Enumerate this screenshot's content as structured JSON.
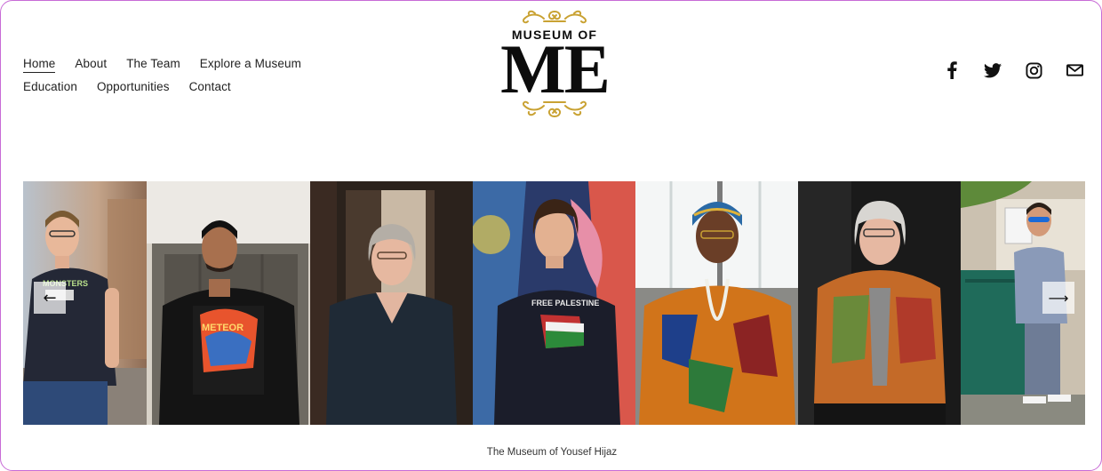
{
  "nav": {
    "row1": [
      {
        "label": "Home",
        "active": true
      },
      {
        "label": "About"
      },
      {
        "label": "The Team"
      },
      {
        "label": "Explore a Museum"
      }
    ],
    "row2": [
      {
        "label": "Education"
      },
      {
        "label": "Opportunities"
      },
      {
        "label": "Contact"
      }
    ]
  },
  "logo": {
    "line1": "MUSEUM OF",
    "line2": "ME",
    "gold": "#c9a233"
  },
  "social": [
    "facebook-icon",
    "twitter-icon",
    "instagram-icon",
    "email-icon"
  ],
  "gallery": {
    "portraits": [
      {
        "name": "portrait-man-monsters-tshirt",
        "shirt_text": "MONSTERS EXIST"
      },
      {
        "name": "portrait-young-man-graphic-tshirt",
        "shirt_text": "METEOR"
      },
      {
        "name": "portrait-woman-grey-hair-polo"
      },
      {
        "name": "portrait-boy-free-palestine-hoodie",
        "shirt_text": "FREE PALESTINE"
      },
      {
        "name": "portrait-elder-woman-headwrap"
      },
      {
        "name": "portrait-elder-woman-patterned-cardigan"
      },
      {
        "name": "portrait-man-sunglasses-green-box"
      }
    ],
    "prev_arrow": "←",
    "next_arrow": "⟶",
    "caption": "The Museum of Yousef Hijaz"
  }
}
